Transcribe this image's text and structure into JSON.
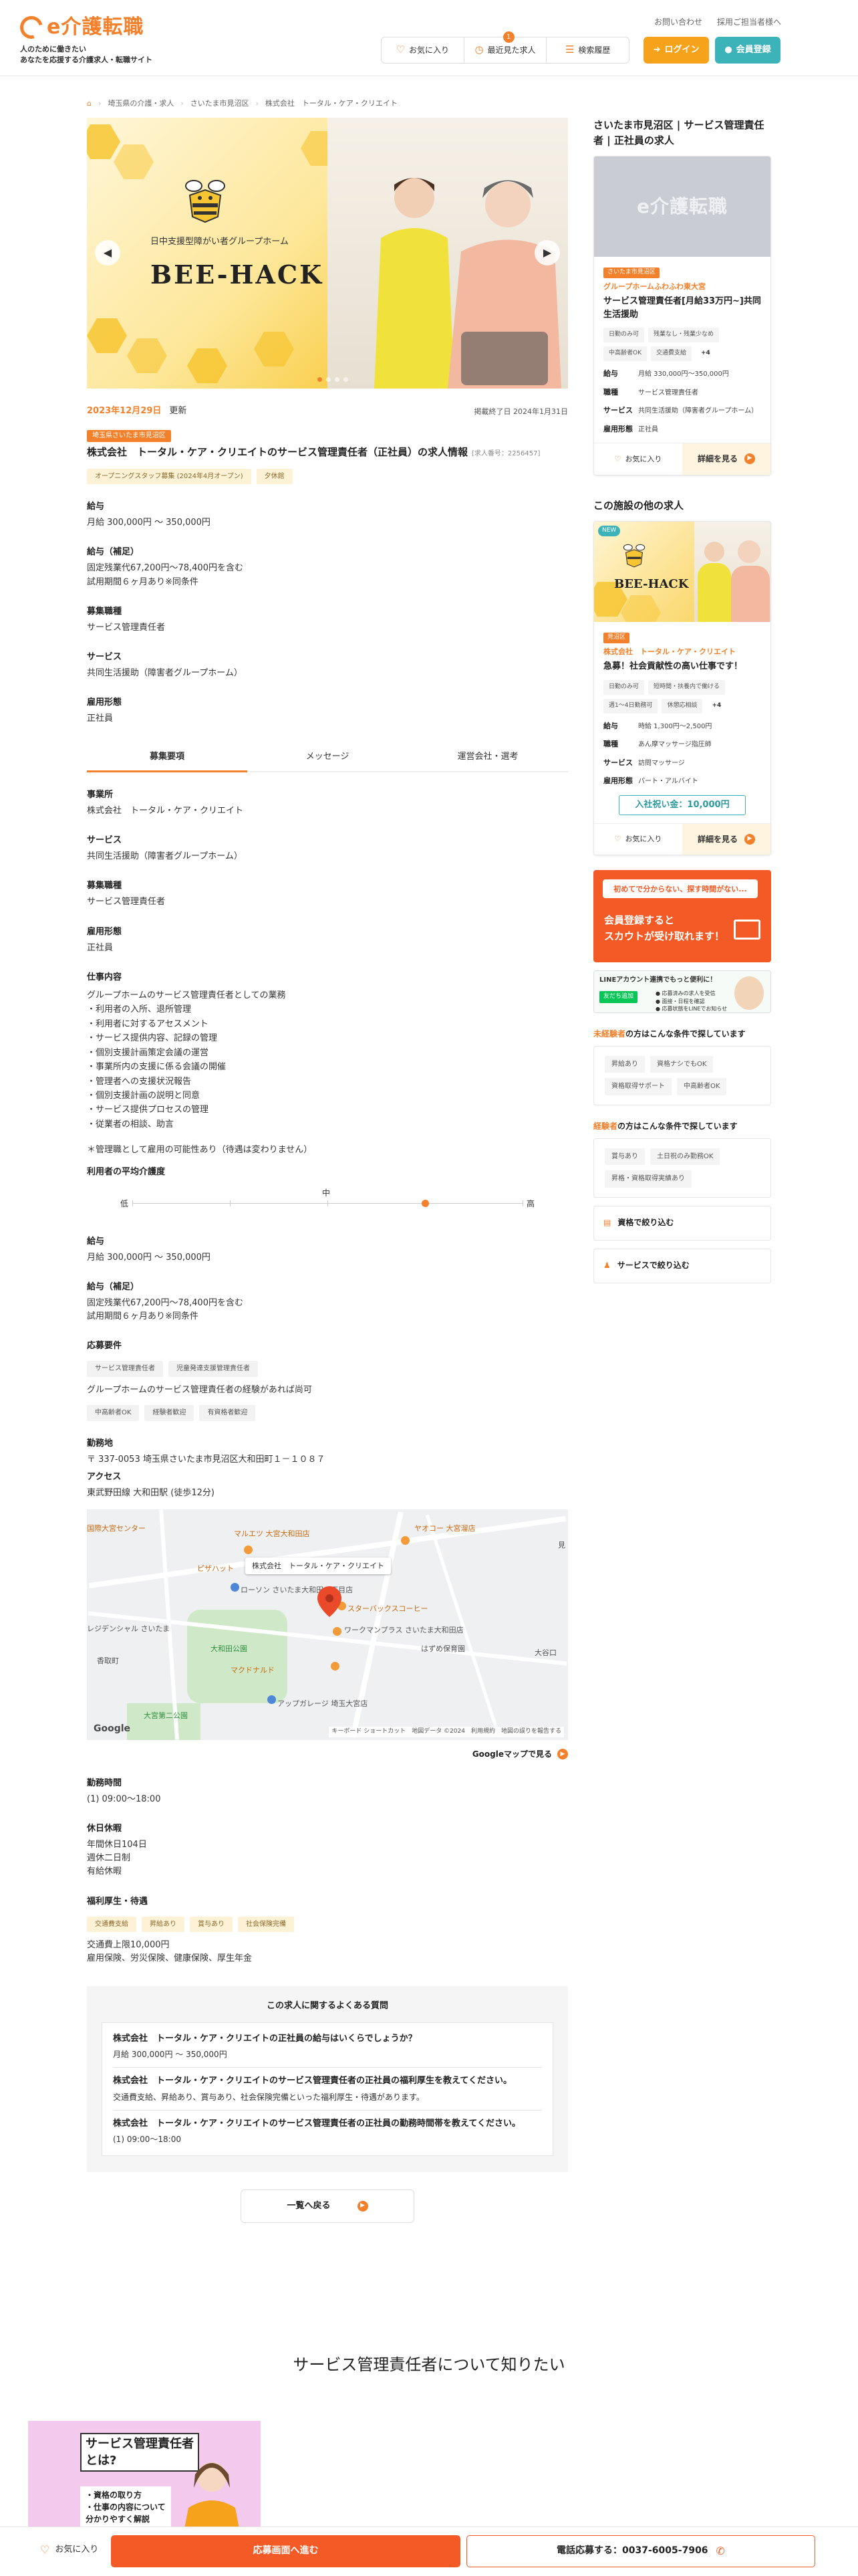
{
  "header": {
    "logo": "e介護転職",
    "tagline_1": "人のために働きたい",
    "tagline_2": "あなたを応援する介護求人・転職サイト",
    "links": [
      "お問い合わせ",
      "採用ご担当者様へ"
    ],
    "favorites": "お気に入り",
    "recent": "最近見た求人",
    "recent_badge": "1",
    "history": "検索履歴",
    "login": "ログイン",
    "register": "会員登録"
  },
  "breadcrumb": [
    "埼玉県の介護・求人",
    "さいたま市見沼区",
    "株式会社　トータル・ケア・クリエイト"
  ],
  "hero": {
    "tagline": "日中支援型障がい者グループホーム",
    "brand": "BEE-HACK"
  },
  "job": {
    "updated_date": "2023年12月29日",
    "updated_label": "更新",
    "deadline": "掲載終了日 2024年1月31日",
    "area": "埼玉県さいたま市見沼区",
    "title": "株式会社　トータル・ケア・クリエイトのサービス管理責任者（正社員）の求人情報",
    "job_no": "[求人番号：2256457]",
    "tags": [
      "オープニングスタッフ募集 (2024年4月オープン)",
      "夕休館"
    ]
  },
  "summary": [
    {
      "label": "給与",
      "value": "月給 300,000円 〜 350,000円"
    },
    {
      "label": "給与（補足）",
      "value": "固定残業代67,200円〜78,400円を含む\n試用期間６ヶ月あり※同条件"
    },
    {
      "label": "募集職種",
      "value": "サービス管理責任者"
    },
    {
      "label": "サービス",
      "value": "共同生活援助（障害者グループホーム）"
    },
    {
      "label": "雇用形態",
      "value": "正社員"
    }
  ],
  "tabs": [
    "募集要項",
    "メッセージ",
    "運営会社・選考"
  ],
  "details": [
    {
      "label": "事業所",
      "value": "株式会社　トータル・ケア・クリエイト"
    },
    {
      "label": "サービス",
      "value": "共同生活援助（障害者グループホーム）"
    },
    {
      "label": "募集職種",
      "value": "サービス管理責任者"
    },
    {
      "label": "雇用形態",
      "value": "正社員"
    }
  ],
  "duties": {
    "label": "仕事内容",
    "intro": "グループホームのサービス管理責任者としての業務",
    "items": [
      "・利用者の入所、退所管理",
      "・利用者に対するアセスメント",
      "・サービス提供内容、記録の管理",
      "・個別支援計画策定会議の運営",
      "・事業所内の支援に係る会議の開催",
      "・管理者への支援状況報告",
      "・個別支援計画の説明と同意",
      "・サービス提供プロセスの管理",
      "・従業者の相談、助言"
    ],
    "note": "＊管理職として雇用の可能性あり（待遇は変わりません）"
  },
  "care_level": {
    "label": "利用者の平均介護度",
    "low": "低",
    "mid": "中",
    "high": "高",
    "level": 0.75
  },
  "salary2": [
    {
      "label": "給与",
      "value": "月給 300,000円 〜 350,000円"
    },
    {
      "label": "給与（補足）",
      "value": "固定残業代67,200円〜78,400円を含む\n試用期間６ヶ月あり※同条件"
    }
  ],
  "requirements": {
    "label": "応募要件",
    "tags": [
      "サービス管理責任者",
      "児童発達支援管理責任者"
    ],
    "text": "グループホームのサービス管理責任者の経験があれば尚可",
    "tags2": [
      "中高齢者OK",
      "経験者歓迎",
      "有資格者歓迎"
    ]
  },
  "location": {
    "label": "勤務地",
    "address": "〒 337-0053 埼玉県さいたま市見沼区大和田町１－１０８７",
    "access_label": "アクセス",
    "access": "東武野田線 大和田駅 (徒歩12分)"
  },
  "map": {
    "popup": "株式会社　トータル・ケア・クリエイト",
    "labels": [
      "マルエツ 大宮大和田店",
      "ヤオコー 大宮溜店",
      "ローソン さいたま大和田一丁目店",
      "スターバックスコーヒー",
      "ワークマンプラス さいたま大和田店",
      "大和田公園",
      "マクドナルド",
      "アップガレージ 埼玉大宮店",
      "大宮第二公園",
      "はずめ保育園",
      "ピザハット",
      "国際大宮センター",
      "レジデンシャル さいたま",
      "香取町",
      "大谷口",
      "見"
    ],
    "google": "Google",
    "credit": "キーボード ショートカット　地図データ ©2024　利用規約　地図の誤りを報告する",
    "link": "Googleマップで見る"
  },
  "hours": {
    "label": "勤務時間",
    "value": "(1) 09:00〜18:00"
  },
  "holidays": {
    "label": "休日休暇",
    "value": "年間休日104日\n週休二日制\n有給休暇"
  },
  "benefits": {
    "label": "福利厚生・待遇",
    "tags": [
      "交通費支給",
      "昇給あり",
      "賞与あり",
      "社会保険完備"
    ],
    "text": "交通費上限10,000円\n雇用保険、労災保険、健康保険、厚生年金"
  },
  "faq": {
    "title": "この求人に関するよくある質問",
    "items": [
      {
        "q": "株式会社　トータル・ケア・クリエイトの正社員の給与はいくらでしょうか？",
        "a": "月給 300,000円 〜 350,000円"
      },
      {
        "q": "株式会社　トータル・ケア・クリエイトのサービス管理責任者の正社員の福利厚生を教えてください。",
        "a": "交通費支給、昇給あり、賞与あり、社会保険完備といった福利厚生・待遇があります。"
      },
      {
        "q": "株式会社　トータル・ケア・クリエイトのサービス管理責任者の正社員の勤務時間帯を教えてください。",
        "a": "(1) 09:00〜18:00"
      }
    ]
  },
  "back_button": "一覧へ戻る",
  "sidebar": {
    "title": "さいたま市見沼区 | サービス管理責任者 | 正社員の求人",
    "card1": {
      "img_logo": "e介護転職",
      "area": "さいたま市見沼区",
      "company": "グループホームふわふわ東大宮",
      "title": "サービス管理責任者[月給33万円~]共同生活援助",
      "chips": [
        "日勤のみ可",
        "残業なし・残業少なめ",
        "中高齢者OK",
        "交通費支給"
      ],
      "more": "+4",
      "info": [
        {
          "k": "給与",
          "v": "月給 330,000円〜350,000円"
        },
        {
          "k": "職種",
          "v": "サービス管理責任者"
        },
        {
          "k": "サービス",
          "v": "共同生活援助（障害者グループホーム）"
        },
        {
          "k": "雇用形態",
          "v": "正社員"
        }
      ],
      "fav": "お気に入り",
      "detail": "詳細を見る"
    },
    "other_title": "この施設の他の求人",
    "card2": {
      "new": "NEW",
      "area": "見沼区",
      "company": "株式会社　トータル・ケア・クリエイト",
      "title": "急募！社会貢献性の高い仕事です！",
      "chips": [
        "日勤のみ可",
        "短時間・扶養内で働ける",
        "週1〜4日勤務可",
        "休憩応相談"
      ],
      "more": "+4",
      "info": [
        {
          "k": "給与",
          "v": "時給 1,300円〜2,500円"
        },
        {
          "k": "職種",
          "v": "あん摩マッサージ指圧師"
        },
        {
          "k": "サービス",
          "v": "訪問マッサージ"
        },
        {
          "k": "雇用形態",
          "v": "パート・アルバイト"
        }
      ],
      "gift": "入社祝い金：10,000円",
      "fav": "お気に入り",
      "detail": "詳細を見る"
    },
    "banner1": {
      "bubble": "初めてで分からない、探す時間がない...",
      "line1": "会員登録すると",
      "line2": "スカウトが受け取れます！"
    },
    "banner2": {
      "text": "LINEアカウント連携でもっと便利に！",
      "badge": "友だち追加",
      "items": [
        "● 応募済みの求人を受信",
        "● 面接・日程を確認",
        "● 応募状態をLINEでお知らせ"
      ]
    },
    "cond1": {
      "prefix": "未経験者",
      "suffix": "の方はこんな条件で探しています",
      "chips": [
        "昇給あり",
        "資格ナシでもOK",
        "資格取得サポート",
        "中高齢者OK"
      ]
    },
    "cond2": {
      "prefix": "経験者",
      "suffix": "の方はこんな条件で探しています",
      "chips": [
        "賞与あり",
        "土日祝のみ勤務OK",
        "昇格・資格取得実績あり"
      ]
    },
    "narrow1": "資格で絞り込む",
    "narrow2": "サービスで絞り込む"
  },
  "about": {
    "title": "サービス管理責任者について知りたい",
    "card_title_1": "サービス管理責任者",
    "card_title_2": "とは?",
    "card_list": [
      "・資格の取り方",
      "・仕事の内容について",
      "分かりやすく解説"
    ]
  },
  "bottom_bar": {
    "fav": "お気に入り",
    "apply": "応募画面へ進む",
    "tel": "電話応募する：0037-6005-7906"
  },
  "colors": {
    "accent": "#f3802b",
    "apply": "#f35a25",
    "teal": "#3bb3b9",
    "yellow": "#f7a21b"
  }
}
